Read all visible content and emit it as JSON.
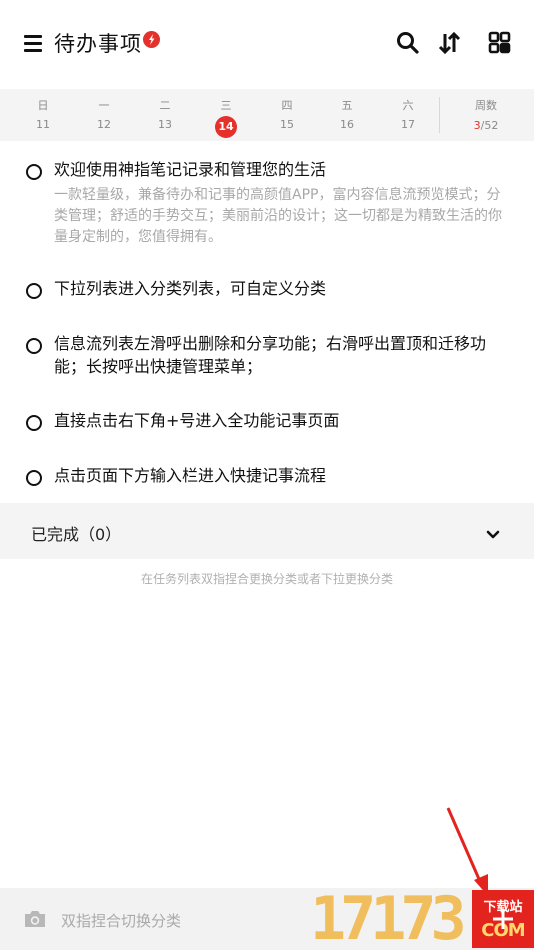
{
  "header": {
    "title": "待办事项",
    "icons": [
      "menu-icon",
      "lightning-badge-icon",
      "search-icon",
      "sort-icon",
      "grid-icon"
    ],
    "accent": "#e4312b"
  },
  "calendar": {
    "days": [
      {
        "weekday": "日",
        "date": "11"
      },
      {
        "weekday": "一",
        "date": "12"
      },
      {
        "weekday": "二",
        "date": "13"
      },
      {
        "weekday": "三",
        "date": "14",
        "today": true
      },
      {
        "weekday": "四",
        "date": "15"
      },
      {
        "weekday": "五",
        "date": "16"
      },
      {
        "weekday": "六",
        "date": "17"
      }
    ],
    "week_label": "周数",
    "week_current": "3",
    "week_total": "/52"
  },
  "tasks": [
    {
      "text": "欢迎使用神指笔记记录和管理您的生活",
      "desc": "一款轻量级，兼备待办和记事的高颜值APP，富内容信息流预览模式；分类管理；舒适的手势交互；美丽前沿的设计；这一切都是为精致生活的你量身定制的，您值得拥有。"
    },
    {
      "text": "下拉列表进入分类列表，可自定义分类"
    },
    {
      "text": "信息流列表左滑呼出删除和分享功能；右滑呼出置顶和迁移功能；长按呼出快捷管理菜单；"
    },
    {
      "text": "直接点击右下角+号进入全功能记事页面"
    },
    {
      "text": "点击页面下方输入栏进入快捷记事流程"
    }
  ],
  "completed": {
    "label": "已完成（0）"
  },
  "hint": "在任务列表双指捏合更换分类或者下拉更换分类",
  "bottom": {
    "placeholder": "双指捏合切换分类",
    "icons": [
      "camera-icon",
      "plus-icon"
    ]
  },
  "watermark": {
    "digits": "17173",
    "site_top": "下载站",
    "site_bottom": "COM"
  }
}
